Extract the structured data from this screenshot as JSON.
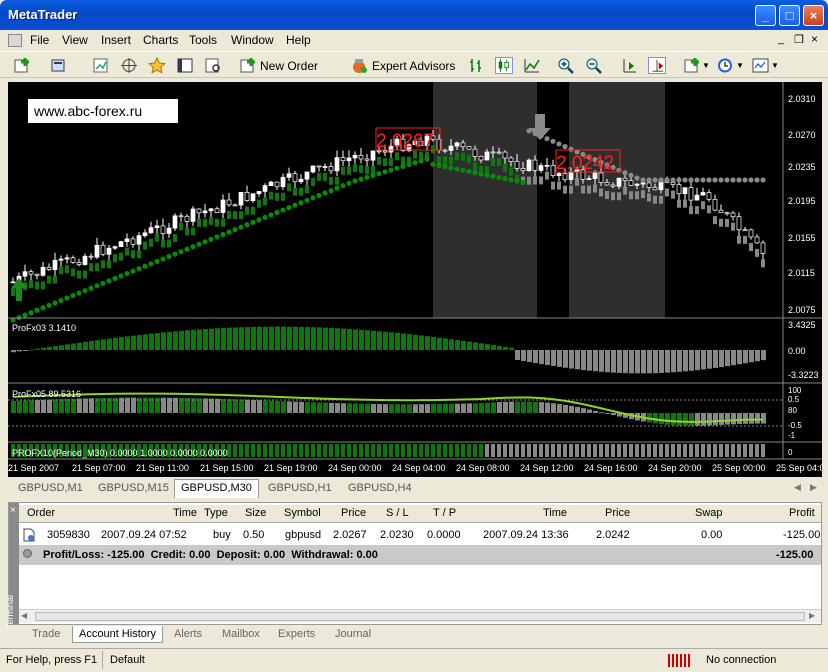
{
  "window": {
    "title": "MetaTrader"
  },
  "menu": [
    "File",
    "View",
    "Insert",
    "Charts",
    "Tools",
    "Window",
    "Help"
  ],
  "toolbar": {
    "new_order": "New Order",
    "expert_advisors": "Expert Advisors"
  },
  "chart": {
    "watermark": "www.abc-forex.ru",
    "price_labels": [
      "2.0310",
      "2.0270",
      "2.0235",
      "2.0195",
      "2.0155",
      "2.0115",
      "2.0075"
    ],
    "label_open": "2.0267",
    "label_close": "2.0242",
    "ind1_label": "ProFx03 3.1410",
    "ind1_ticks": [
      "3.4325",
      "0.00",
      "-3.3223"
    ],
    "ind2_label": "ProFx05 89.5316",
    "ind2_ticks": [
      "100",
      "0.5",
      "80",
      "-0.5",
      "-1",
      "0"
    ],
    "ind3_label": "PROFX10(Period_M30) 0.0000 1.0000 0.0000 0.0000",
    "time_labels": [
      "21 Sep 2007",
      "21 Sep 07:00",
      "21 Sep 11:00",
      "21 Sep 15:00",
      "21 Sep 19:00",
      "24 Sep 00:00",
      "24 Sep 04:00",
      "24 Sep 08:00",
      "24 Sep 12:00",
      "24 Sep 16:00",
      "24 Sep 20:00",
      "25 Sep 00:00",
      "25 Sep 04:00"
    ],
    "colors": {
      "bull": "#0b7a0b",
      "bear": "#888888",
      "ma_green": "#0a8a0a",
      "ma_gray": "#8a8a8a",
      "label_red": "#ff2020"
    }
  },
  "chart_tabs": [
    "GBPUSD,M1",
    "GBPUSD,M15",
    "GBPUSD,M30",
    "GBPUSD,H1",
    "GBPUSD,H4"
  ],
  "active_chart_tab": "GBPUSD,M30",
  "terminal": {
    "columns": [
      "Order",
      "Time",
      "Type",
      "Size",
      "Symbol",
      "Price",
      "S / L",
      "T / P",
      "Time",
      "Price",
      "Swap",
      "Profit"
    ],
    "row": {
      "order": "3059830",
      "time": "2007.09.24 07:52",
      "type": "buy",
      "size": "0.50",
      "symbol": "gbpusd",
      "price": "2.0267",
      "sl": "2.0230",
      "tp": "0.0000",
      "time2": "2007.09.24 13:36",
      "price2": "2.0242",
      "swap": "0.00",
      "profit": "-125.00"
    },
    "summary": "Profit/Loss: -125.00  Credit: 0.00  Deposit: 0.00  Withdrawal: 0.00",
    "summary_total": "-125.00",
    "side_label": "Terminal"
  },
  "bottom_tabs": [
    "Trade",
    "Account History",
    "Alerts",
    "Mailbox",
    "Experts",
    "Journal"
  ],
  "active_bottom_tab": "Account History",
  "status": {
    "help": "For Help, press F1",
    "profile": "Default",
    "connection": "No connection"
  }
}
